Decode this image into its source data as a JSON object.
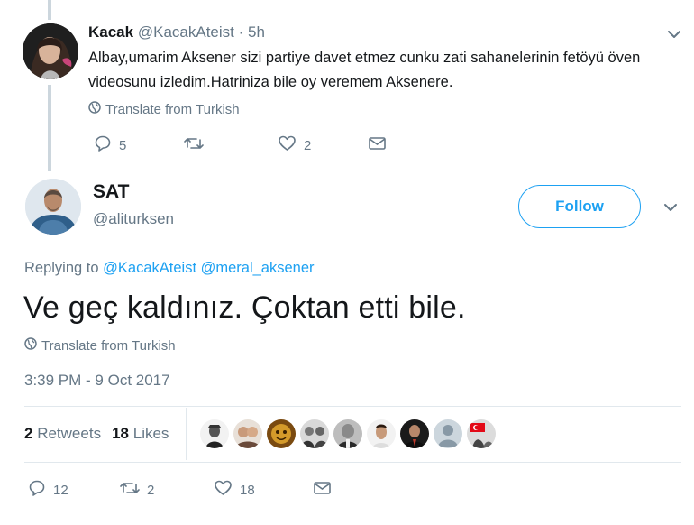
{
  "reply": {
    "name": "Kacak",
    "handle": "@KacakAteist",
    "separator": "·",
    "time": "5h",
    "text": "Albay,umarim Aksener sizi partiye davet etmez cunku zati sahanelerinin fetöyü öven videosunu izledim.Hatriniza bile oy veremem Aksenere.",
    "translate": "Translate from Turkish",
    "actions": {
      "replies": "5",
      "retweets": "",
      "likes": "2"
    }
  },
  "main": {
    "name": "SAT",
    "handle": "@aliturksen",
    "follow_label": "Follow",
    "replying_prefix": "Replying to",
    "mentions": [
      "@KacakAteist",
      "@meral_aksener"
    ],
    "text": "Ve geç kaldınız. Çoktan etti bile.",
    "translate": "Translate from Turkish",
    "timestamp": "3:39 PM - 9 Oct 2017",
    "stats": {
      "retweets_count": "2",
      "retweets_label": "Retweets",
      "likes_count": "18",
      "likes_label": "Likes"
    },
    "actions": {
      "replies": "12",
      "retweets": "2",
      "likes": "18"
    }
  },
  "icons": {
    "reply": "reply-icon",
    "retweet": "retweet-icon",
    "like": "heart-icon",
    "dm": "envelope-icon",
    "globe": "globe-icon",
    "caret": "chevron-down-icon"
  },
  "colors": {
    "accent": "#1da1f2",
    "muted": "#657786",
    "text": "#14171a",
    "border": "#e1e8ed",
    "thread": "#ccd6dd"
  }
}
